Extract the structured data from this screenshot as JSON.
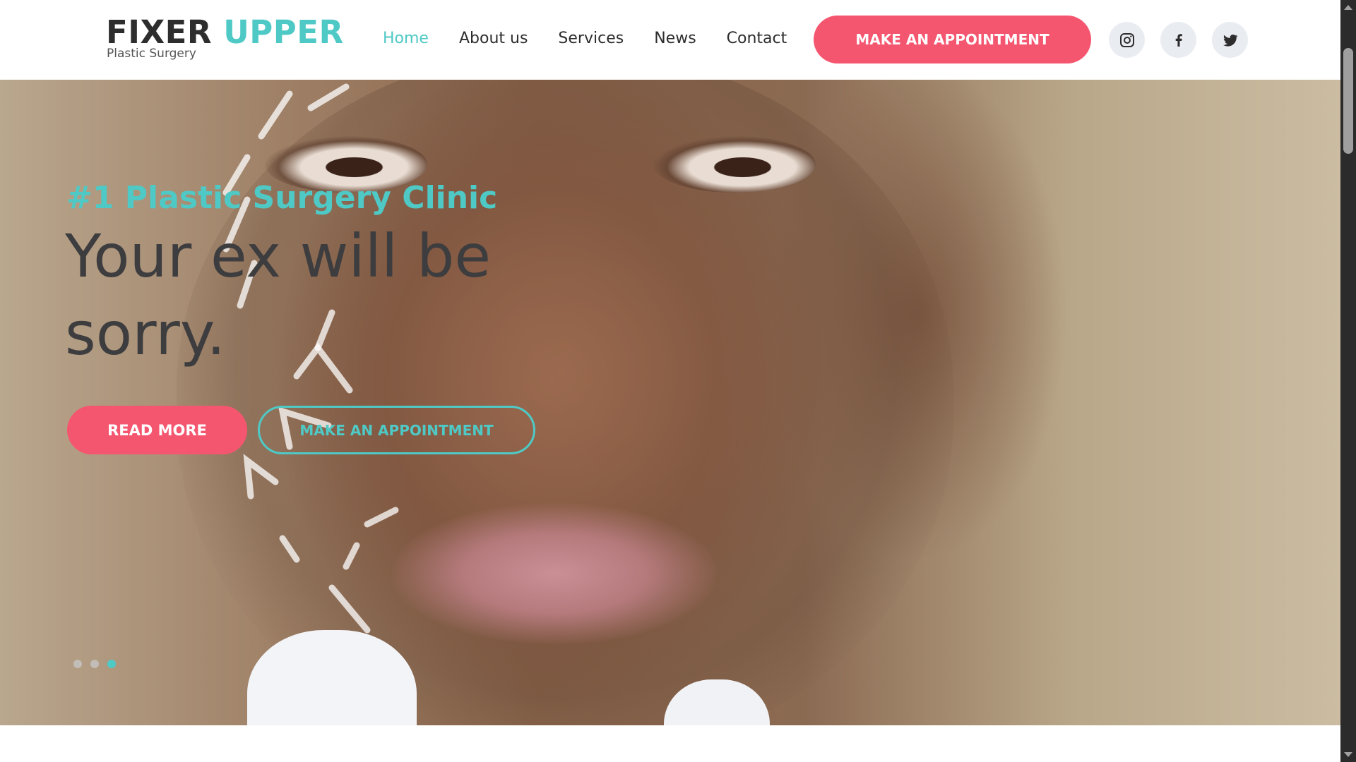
{
  "brand": {
    "name_part1": "FIXER",
    "name_part2": "UPPER",
    "tagline": "Plastic Surgery",
    "accent_color": "#4fc9c5",
    "cta_color": "#f5566f"
  },
  "nav": {
    "items": [
      {
        "label": "Home",
        "active": true
      },
      {
        "label": "About us",
        "active": false
      },
      {
        "label": "Services",
        "active": false
      },
      {
        "label": "News",
        "active": false
      },
      {
        "label": "Contact",
        "active": false
      }
    ],
    "cta_label": "MAKE AN APPOINTMENT"
  },
  "social": {
    "icons": [
      "instagram-icon",
      "facebook-icon",
      "twitter-icon"
    ]
  },
  "hero": {
    "kicker": "#1 Plastic Surgery Clinic",
    "title": "Your ex will be sorry.",
    "read_more_label": "READ MORE",
    "appointment_label": "MAKE AN APPOINTMENT",
    "slides_total": 3,
    "active_slide": 3
  }
}
